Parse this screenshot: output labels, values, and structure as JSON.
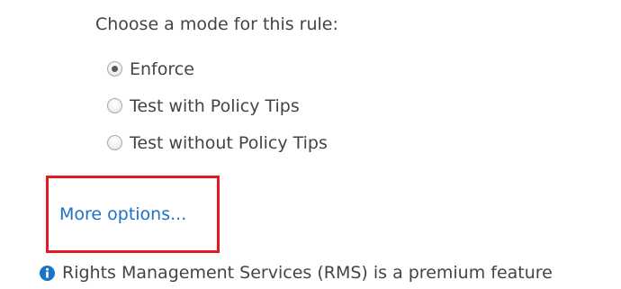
{
  "mode_section": {
    "prompt": "Choose a mode for this rule:",
    "options": [
      {
        "label": "Enforce",
        "checked": true
      },
      {
        "label": "Test with Policy Tips",
        "checked": false
      },
      {
        "label": "Test without Policy Tips",
        "checked": false
      }
    ]
  },
  "more_options_link": "More options...",
  "notice": {
    "icon": "info-icon",
    "text": "Rights Management Services (RMS) is a premium feature"
  },
  "colors": {
    "link": "#1f6fc6",
    "highlight": "#e21b22",
    "info_icon": "#1a73c8"
  }
}
